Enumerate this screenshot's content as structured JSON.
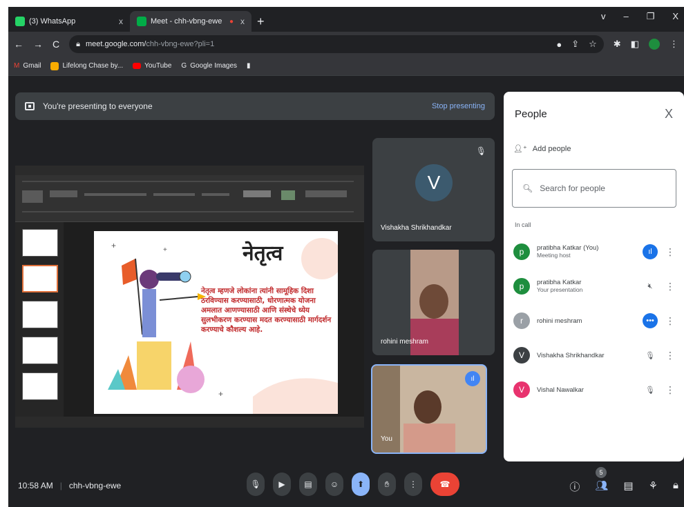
{
  "browser": {
    "tabs": [
      {
        "label": "(3) WhatsApp",
        "close": "x"
      },
      {
        "label": "Meet - chh-vbng-ewe",
        "close": "x"
      }
    ],
    "new_tab": "+",
    "window_controls": [
      "v",
      "–",
      "❐",
      "X"
    ],
    "url": "meet.google.com/",
    "url_rest": "chh-vbng-ewe?pli=1",
    "bookmarks": [
      "Gmail",
      "Lifelong Chase by...",
      "YouTube",
      "Google Images"
    ]
  },
  "banner": {
    "text": "You're presenting to everyone",
    "stop": "Stop presenting"
  },
  "slide": {
    "title": "नेतृत्व",
    "body": "नेतृत्व म्हणजे लोकांना त्यांनी सामूहिक दिशा ठरविण्यास करण्यासाठी, धोरणात्मक योजना अमलात आणण्यासाठी आणि संस्थेचे ध्येय सुलभीकरण करण्यास मदत करण्यासाठी मार्गदर्शन करण्याचे कौशल्य आहे."
  },
  "tiles": [
    {
      "name": "Vishakha Shrikhandkar",
      "initial": "V"
    },
    {
      "name": "rohini meshram"
    },
    {
      "name": "You"
    }
  ],
  "panel": {
    "title": "People",
    "close": "X",
    "add_people": "Add people",
    "search_placeholder": "Search for people",
    "section": "In call",
    "people": [
      {
        "initial": "p",
        "name": "pratibha Katkar (You)",
        "sub": "Meeting host",
        "color": "#1e8e3e",
        "status": "speaking"
      },
      {
        "initial": "p",
        "name": "pratibha Katkar",
        "sub": "Your presentation",
        "color": "#1e8e3e",
        "status": "muted"
      },
      {
        "initial": "r",
        "name": "rohini meshram",
        "sub": "",
        "color": "#9aa0a6",
        "status": "more"
      },
      {
        "initial": "V",
        "name": "Vishakha Shrikhandkar",
        "sub": "",
        "color": "#3c4043",
        "status": "mic-off"
      },
      {
        "initial": "V",
        "name": "Vishal Nawalkar",
        "sub": "",
        "color": "#e8336e",
        "status": "mic-off"
      }
    ]
  },
  "bottom": {
    "time": "10:58 AM",
    "meeting_code": "chh-vbng-ewe",
    "people_count": "5"
  }
}
